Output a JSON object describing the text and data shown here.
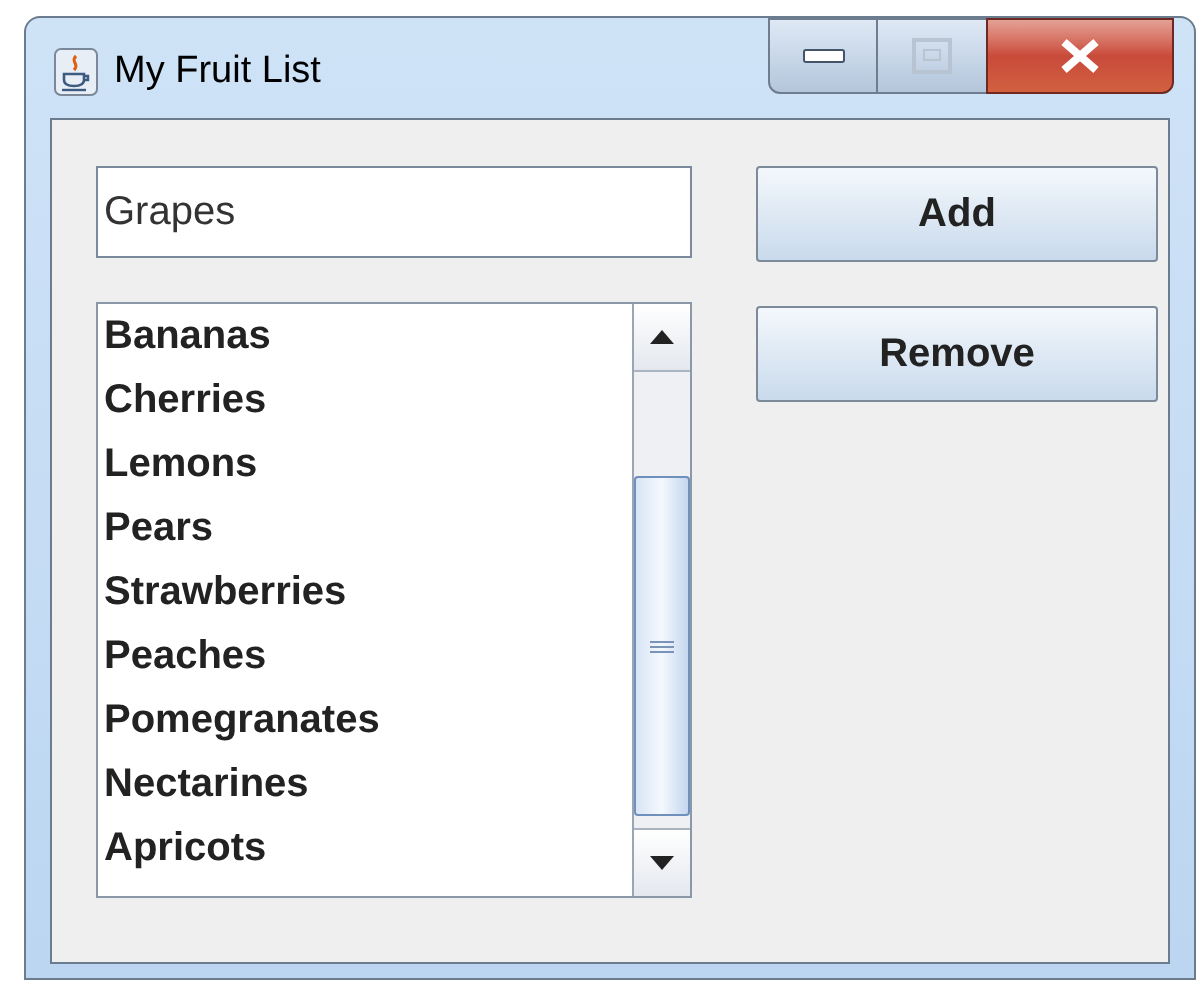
{
  "window": {
    "title": "My Fruit List"
  },
  "text_field": {
    "value": "Grapes"
  },
  "buttons": [
    {
      "label": "Add"
    },
    {
      "label": "Remove"
    }
  ],
  "fruit_list": {
    "items": [
      "Bananas",
      "Cherries",
      "Lemons",
      "Pears",
      "Strawberries",
      "Peaches",
      "Pomegranates",
      "Nectarines",
      "Apricots"
    ]
  }
}
